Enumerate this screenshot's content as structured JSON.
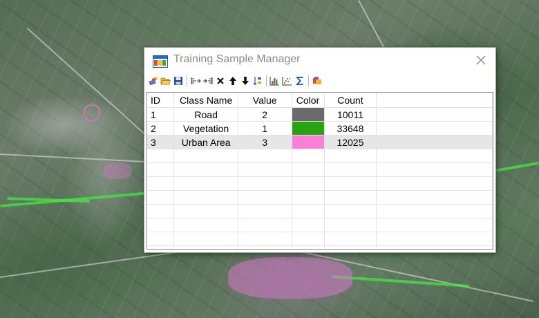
{
  "window": {
    "title": "Training Sample Manager"
  },
  "toolbar": {
    "buttons": [
      {
        "icon": "new-sample-icon"
      },
      {
        "icon": "open-folder-icon"
      },
      {
        "icon": "save-icon"
      },
      {
        "icon": "merge-classes-icon"
      },
      {
        "icon": "split-class-icon"
      },
      {
        "icon": "delete-icon"
      },
      {
        "icon": "arrow-up-icon"
      },
      {
        "icon": "arrow-down-icon"
      },
      {
        "icon": "sort-icon"
      },
      {
        "icon": "histogram-icon"
      },
      {
        "icon": "scatterplot-icon"
      },
      {
        "icon": "statistics-sigma-icon"
      },
      {
        "icon": "show-samples-icon"
      }
    ]
  },
  "table": {
    "columns": [
      "ID",
      "Class Name",
      "Value",
      "Color",
      "Count"
    ],
    "rows": [
      {
        "id": "1",
        "class_name": "Road",
        "value": "2",
        "color": "#6b6b6b",
        "count": "10011"
      },
      {
        "id": "2",
        "class_name": "Vegetation",
        "value": "1",
        "color": "#27a30f",
        "count": "33648"
      },
      {
        "id": "3",
        "class_name": "Urban Area",
        "value": "3",
        "color": "#ff7fd8",
        "count": "12025"
      }
    ],
    "selected_row_index": 2
  },
  "colors": {
    "title_text": "#8a8a8a",
    "selection": "#e6e6e6",
    "grid_line": "#e3e3e3"
  }
}
